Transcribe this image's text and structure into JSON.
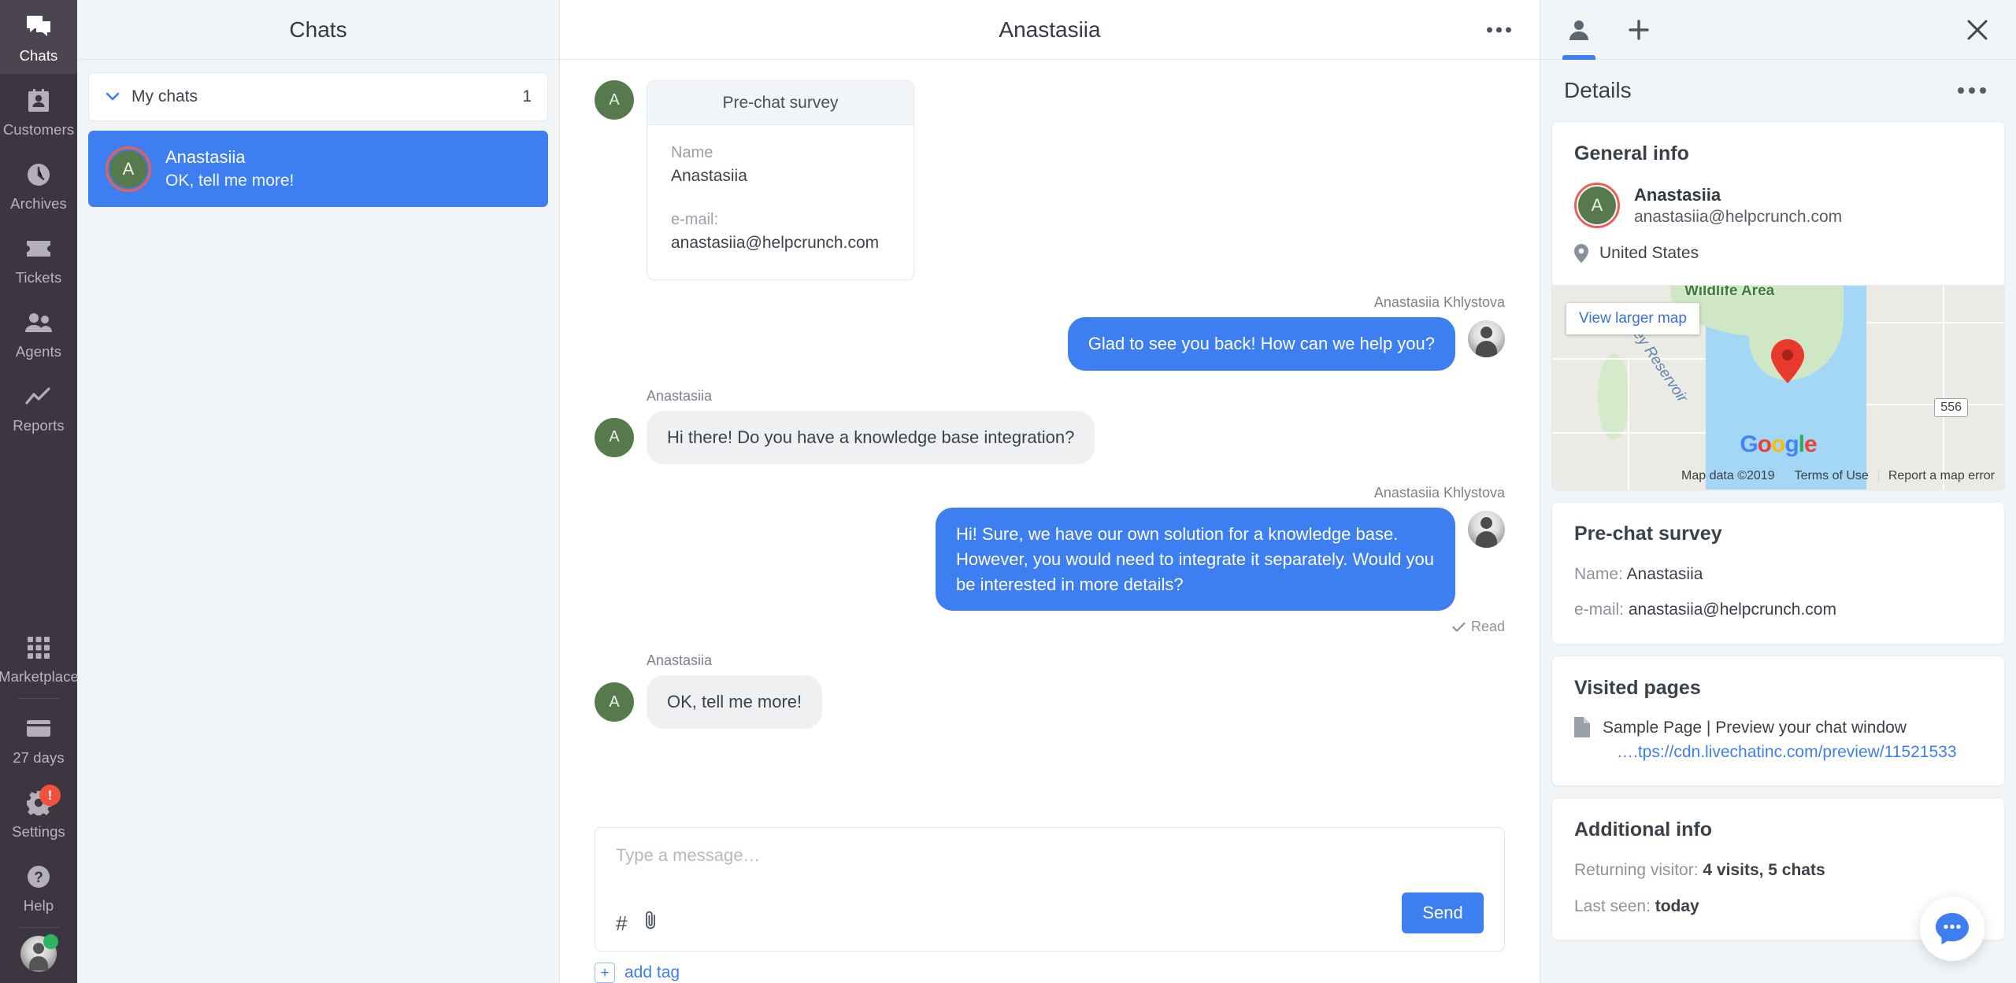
{
  "rail": {
    "top_items": [
      {
        "label": "Chats",
        "icon": "chats-icon",
        "active": true
      },
      {
        "label": "Customers",
        "icon": "customers-icon",
        "active": false
      },
      {
        "label": "Archives",
        "icon": "archives-clock-icon",
        "active": false
      },
      {
        "label": "Tickets",
        "icon": "ticket-icon",
        "active": false
      },
      {
        "label": "Agents",
        "icon": "agents-icon",
        "active": false
      },
      {
        "label": "Reports",
        "icon": "reports-chart-icon",
        "active": false
      }
    ],
    "bottom_items": [
      {
        "label": "Marketplace",
        "icon": "marketplace-grid-icon",
        "badge": ""
      },
      {
        "label": "27 days",
        "icon": "billing-card-icon",
        "badge": ""
      },
      {
        "label": "Settings",
        "icon": "gear-icon",
        "badge": "!"
      },
      {
        "label": "Help",
        "icon": "help-question-icon",
        "badge": ""
      }
    ]
  },
  "chats_panel": {
    "title": "Chats",
    "group": {
      "label": "My chats",
      "count": "1"
    },
    "items": [
      {
        "avatar_initial": "A",
        "name": "Anastasiia",
        "snippet": "OK, tell me more!"
      }
    ]
  },
  "conversation": {
    "title": "Anastasiia",
    "survey": {
      "header": "Pre-chat survey",
      "name_label": "Name",
      "name_value": "Anastasiia",
      "email_label": "e-mail:",
      "email_value": "anastasiia@helpcrunch.com"
    },
    "messages": [
      {
        "side": "right",
        "sender": "Anastasiia Khlystova",
        "text": "Glad to see you back! How can we help you?",
        "receipt": ""
      },
      {
        "side": "left",
        "sender": "Anastasiia",
        "avatar_initial": "A",
        "text": "Hi there! Do you have a knowledge base integration?",
        "receipt": ""
      },
      {
        "side": "right",
        "sender": "Anastasiia Khlystova",
        "text": "Hi! Sure, we have our own solution for a knowledge base. However, you would need to integrate it separately. Would you be interested in more details?",
        "receipt": "Read"
      },
      {
        "side": "left",
        "sender": "Anastasiia",
        "avatar_initial": "A",
        "text": "OK, tell me more!",
        "receipt": ""
      }
    ],
    "composer": {
      "placeholder": "Type a message…",
      "send_label": "Send",
      "hash_icon": "#",
      "attach_icon": "paperclip-icon"
    },
    "tag": {
      "plus": "+",
      "label": "add tag"
    }
  },
  "details": {
    "tabs": [
      {
        "icon": "person-icon",
        "active": true
      },
      {
        "icon": "plus-icon",
        "active": false
      }
    ],
    "close_icon": "close-icon",
    "title": "Details",
    "general": {
      "title": "General info",
      "avatar_initial": "A",
      "name": "Anastasiia",
      "email": "anastasiia@helpcrunch.com",
      "country": "United States"
    },
    "map": {
      "view_larger": "View larger map",
      "wildlife_label": "Wildlife Area",
      "reservoir_label": "ey Reservoir",
      "route_badge": "556",
      "google_letters": [
        "G",
        "o",
        "o",
        "g",
        "l",
        "e"
      ],
      "footer": [
        "Map data ©2019",
        "Terms of Use",
        "Report a map error"
      ]
    },
    "survey": {
      "title": "Pre-chat survey",
      "rows": [
        {
          "label": "Name: ",
          "value": "Anastasiia"
        },
        {
          "label": "e-mail: ",
          "value": "anastasiia@helpcrunch.com"
        }
      ]
    },
    "visited": {
      "title": "Visited pages",
      "page_title": "Sample Page | Preview your chat window",
      "page_url": "….tps://cdn.livechatinc.com/preview/11521533"
    },
    "additional": {
      "title": "Additional info",
      "rows": [
        {
          "label": "Returning visitor: ",
          "value": "4 visits, 5 chats"
        },
        {
          "label": "Last seen: ",
          "value": "today"
        }
      ]
    }
  },
  "colors": {
    "accent_blue": "#3d7ef0",
    "rail_bg": "#3b363f",
    "panel_bg": "#f2f5f7",
    "avatar_green": "#567a4d",
    "ring_red": "#ef5d55",
    "badge_red": "#f4503c",
    "presence_green": "#2eb561"
  }
}
